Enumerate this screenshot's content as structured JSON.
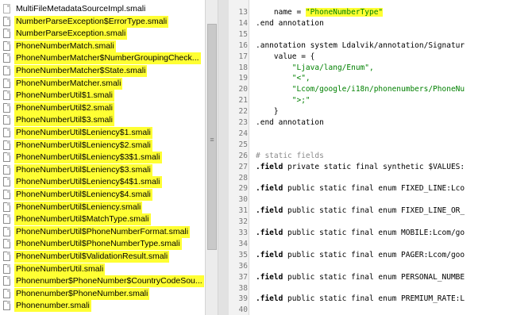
{
  "files": [
    {
      "name": "MultiFileMetadataSourceImpl.smali",
      "highlighted": false
    },
    {
      "name": "NumberParseException$ErrorType.smali",
      "highlighted": true
    },
    {
      "name": "NumberParseException.smali",
      "highlighted": true
    },
    {
      "name": "PhoneNumberMatch.smali",
      "highlighted": true
    },
    {
      "name": "PhoneNumberMatcher$NumberGroupingCheck...",
      "highlighted": true
    },
    {
      "name": "PhoneNumberMatcher$State.smali",
      "highlighted": true
    },
    {
      "name": "PhoneNumberMatcher.smali",
      "highlighted": true
    },
    {
      "name": "PhoneNumberUtil$1.smali",
      "highlighted": true
    },
    {
      "name": "PhoneNumberUtil$2.smali",
      "highlighted": true
    },
    {
      "name": "PhoneNumberUtil$3.smali",
      "highlighted": true
    },
    {
      "name": "PhoneNumberUtil$Leniency$1.smali",
      "highlighted": true
    },
    {
      "name": "PhoneNumberUtil$Leniency$2.smali",
      "highlighted": true
    },
    {
      "name": "PhoneNumberUtil$Leniency$3$1.smali",
      "highlighted": true
    },
    {
      "name": "PhoneNumberUtil$Leniency$3.smali",
      "highlighted": true
    },
    {
      "name": "PhoneNumberUtil$Leniency$4$1.smali",
      "highlighted": true
    },
    {
      "name": "PhoneNumberUtil$Leniency$4.smali",
      "highlighted": true
    },
    {
      "name": "PhoneNumberUtil$Leniency.smali",
      "highlighted": true
    },
    {
      "name": "PhoneNumberUtil$MatchType.smali",
      "highlighted": true
    },
    {
      "name": "PhoneNumberUtil$PhoneNumberFormat.smali",
      "highlighted": true
    },
    {
      "name": "PhoneNumberUtil$PhoneNumberType.smali",
      "highlighted": true
    },
    {
      "name": "PhoneNumberUtil$ValidationResult.smali",
      "highlighted": true
    },
    {
      "name": "PhoneNumberUtil.smali",
      "highlighted": true
    },
    {
      "name": "Phonenumber$PhoneNumber$CountryCodeSou...",
      "highlighted": true
    },
    {
      "name": "Phonenumber$PhoneNumber.smali",
      "highlighted": true
    },
    {
      "name": "Phonenumber.smali",
      "highlighted": true
    }
  ],
  "code_lines": [
    {
      "num": "13",
      "text": "    name = ",
      "highlight_string": "\"PhoneNumberType\"",
      "style": "plain"
    },
    {
      "num": "14",
      "text": ".end annotation",
      "style": "plain"
    },
    {
      "num": "15",
      "text": "",
      "style": "plain"
    },
    {
      "num": "16",
      "text": ".annotation system Ldalvik/annotation/Signatur",
      "style": "plain"
    },
    {
      "num": "17",
      "text": "    value = {",
      "style": "plain"
    },
    {
      "num": "18",
      "text": "        \"Ljava/lang/Enum\",",
      "style": "string"
    },
    {
      "num": "19",
      "text": "        \"<\",",
      "style": "string"
    },
    {
      "num": "20",
      "text": "        \"Lcom/google/i18n/phonenumbers/PhoneNu",
      "style": "string"
    },
    {
      "num": "21",
      "text": "        \">;\"",
      "style": "string"
    },
    {
      "num": "22",
      "text": "    }",
      "style": "plain"
    },
    {
      "num": "23",
      "text": ".end annotation",
      "style": "plain"
    },
    {
      "num": "24",
      "text": "",
      "style": "plain"
    },
    {
      "num": "25",
      "text": "",
      "style": "plain"
    },
    {
      "num": "26",
      "text": "# static fields",
      "style": "comment"
    },
    {
      "num": "27",
      "text": ".field private static final synthetic $VALUES:",
      "style": "field"
    },
    {
      "num": "28",
      "text": "",
      "style": "plain"
    },
    {
      "num": "29",
      "text": ".field public static final enum FIXED_LINE:Lco",
      "style": "field"
    },
    {
      "num": "30",
      "text": "",
      "style": "plain"
    },
    {
      "num": "31",
      "text": ".field public static final enum FIXED_LINE_OR_",
      "style": "field"
    },
    {
      "num": "32",
      "text": "",
      "style": "plain"
    },
    {
      "num": "33",
      "text": ".field public static final enum MOBILE:Lcom/go",
      "style": "field"
    },
    {
      "num": "34",
      "text": "",
      "style": "plain"
    },
    {
      "num": "35",
      "text": ".field public static final enum PAGER:Lcom/goo",
      "style": "field"
    },
    {
      "num": "36",
      "text": "",
      "style": "plain"
    },
    {
      "num": "37",
      "text": ".field public static final enum PERSONAL_NUMBE",
      "style": "field"
    },
    {
      "num": "38",
      "text": "",
      "style": "plain"
    },
    {
      "num": "39",
      "text": ".field public static final enum PREMIUM_RATE:L",
      "style": "field"
    },
    {
      "num": "40",
      "text": "",
      "style": "plain"
    }
  ],
  "scroll_grip": "≡",
  "colors": {
    "highlight": "#ffff33",
    "string": "#008000",
    "comment": "#8a8a8a"
  }
}
